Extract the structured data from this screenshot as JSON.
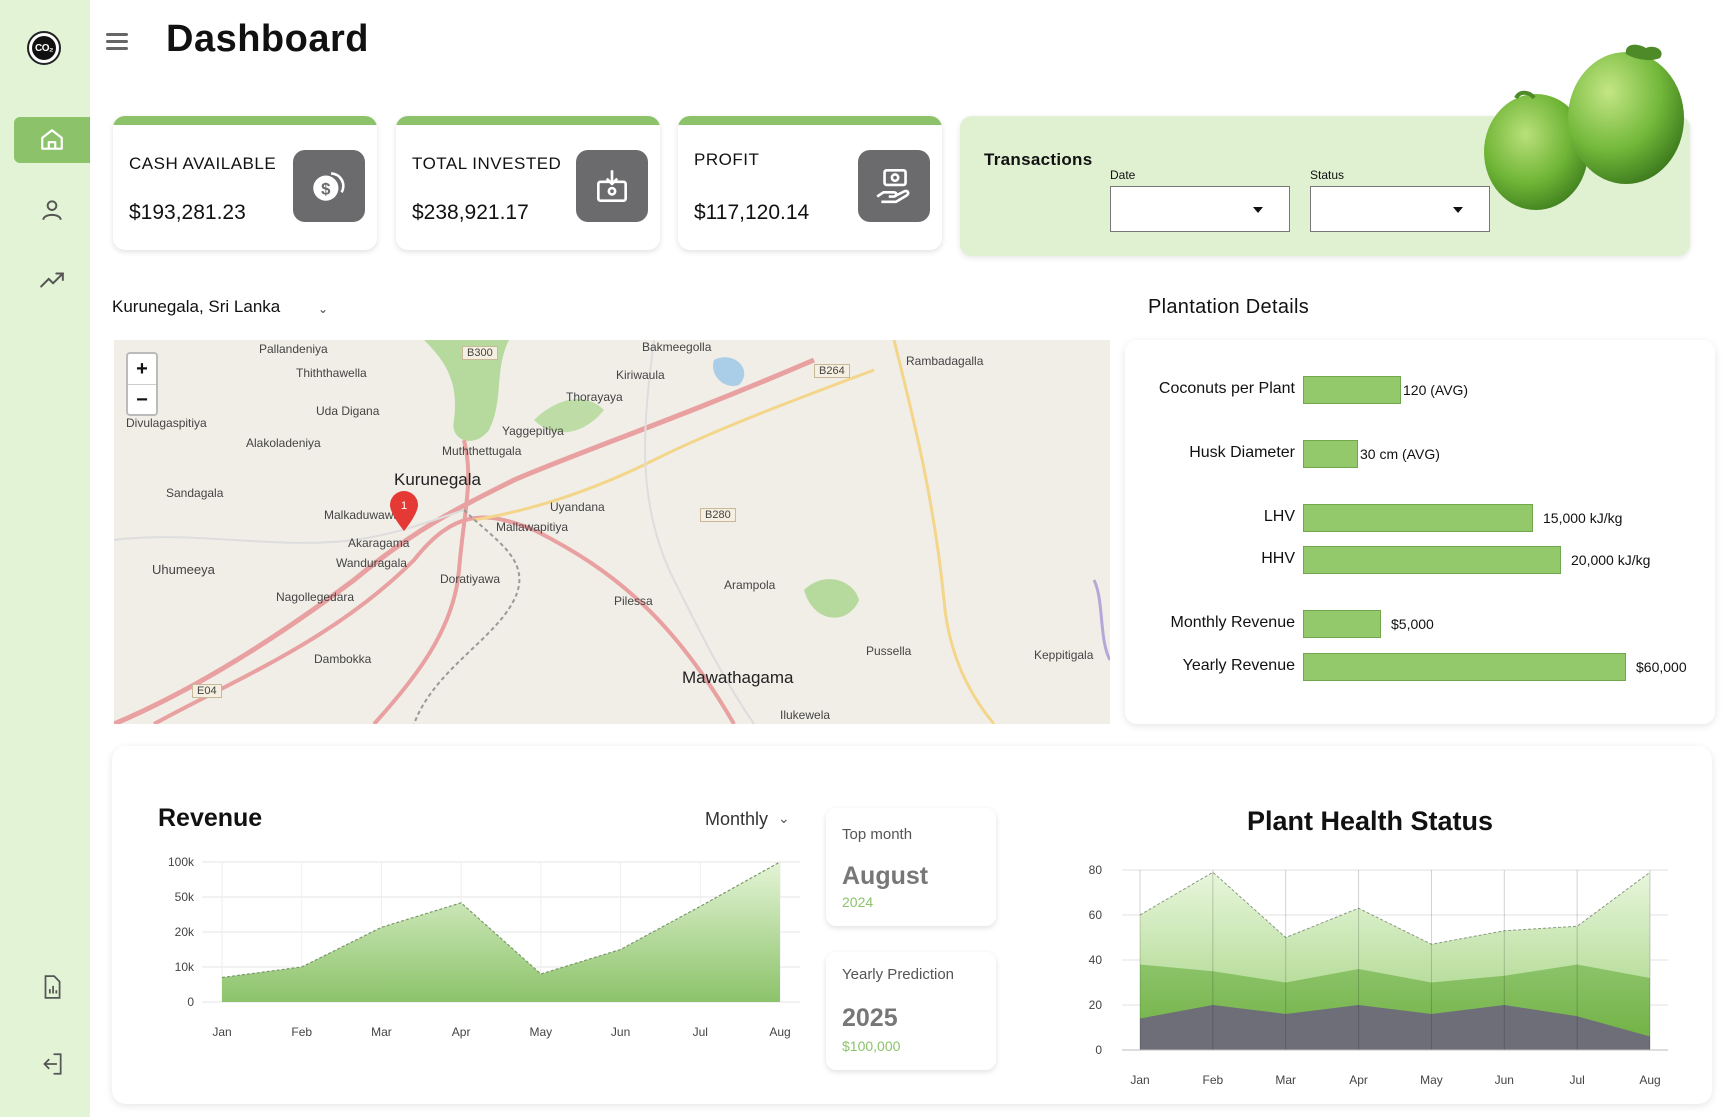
{
  "app": {
    "title": "Dashboard",
    "logo_text": "CO₂"
  },
  "sidebar": {
    "items": [
      {
        "name": "home",
        "icon": "home-icon",
        "active": true
      },
      {
        "name": "profile",
        "icon": "user-icon"
      },
      {
        "name": "analytics",
        "icon": "trending-up-icon"
      },
      {
        "name": "reports",
        "icon": "report-icon"
      },
      {
        "name": "logout",
        "icon": "logout-icon"
      }
    ]
  },
  "stats": [
    {
      "label": "CASH AVAILABLE",
      "value": "$193,281.23",
      "icon": "coins-icon"
    },
    {
      "label": "TOTAL INVESTED",
      "value": "$238,921.17",
      "icon": "invest-box-icon"
    },
    {
      "label": "PROFIT",
      "value": "$117,120.14",
      "icon": "money-hand-icon"
    }
  ],
  "transactions": {
    "title": "Transactions",
    "date_label": "Date",
    "status_label": "Status",
    "date_value": "",
    "status_value": ""
  },
  "location": {
    "selected": "Kurunegala, Sri Lanka"
  },
  "map": {
    "labels": [
      "Pallandeniya",
      "Thiththawella",
      "Uda Digana",
      "Divulagaspitiya",
      "Alakoladeniya",
      "Sandagala",
      "Malkaduwawa",
      "Akaragama",
      "Wanduragala",
      "Uhumeeya",
      "Nagollegedara",
      "Dambokka",
      "Bakmeegolla",
      "Kiriwaula",
      "Thorayaya",
      "Yaggepitiya",
      "Muththettugala",
      "Uyandana",
      "Mallawapitiya",
      "Doratiyawa",
      "Pilessa",
      "Arampola",
      "Rambadagalla",
      "Pussella",
      "Keppitigala",
      "Ilukewela"
    ],
    "big_labels": [
      "Kurunegala",
      "Mawathagama"
    ],
    "roads": [
      "B300",
      "B264",
      "B280",
      "E04"
    ],
    "zoom_in": "+",
    "zoom_out": "−",
    "marker_count": "1"
  },
  "plantation": {
    "title": "Plantation Details",
    "rows": [
      {
        "label": "Coconuts per Plant",
        "value_text": "120 (AVG)",
        "value": 120
      },
      {
        "label": "Husk Diameter",
        "value_text": "30 cm  (AVG)",
        "value": 30
      },
      {
        "label": "LHV",
        "value_text": "15,000 kJ/kg",
        "value": 15000
      },
      {
        "label": "HHV",
        "value_text": "20,000 kJ/kg",
        "value": 20000
      },
      {
        "label": "Monthly Revenue",
        "value_text": "$5,000",
        "value": 5000
      },
      {
        "label": "Yearly Revenue",
        "value_text": "$60,000",
        "value": 60000
      }
    ]
  },
  "revenue": {
    "title": "Revenue",
    "period": "Monthly"
  },
  "top_month": {
    "label": "Top month",
    "month": "August",
    "year": "2024"
  },
  "prediction": {
    "label": "Yearly Prediction",
    "year": "2025",
    "amount": "$100,000"
  },
  "health": {
    "title": "Plant Health Status"
  },
  "colors": {
    "accent": "#8cc36a",
    "sidebar_bg": "#e3f3d6",
    "card_green": "#e0f1d1",
    "icon_bg": "#6b6b6d"
  },
  "chart_data": [
    {
      "type": "area",
      "x": [
        "Jan",
        "Feb",
        "Mar",
        "Apr",
        "May",
        "Jun",
        "Jul",
        "Aug"
      ],
      "y_ticks": [
        "100k",
        "50k",
        "20k",
        "10k",
        "0"
      ],
      "series": [
        {
          "values": [
            7000,
            10000,
            24000,
            45000,
            8000,
            15000,
            42000,
            100000
          ]
        }
      ],
      "ylim": [
        0,
        100000
      ],
      "grid": true
    },
    {
      "type": "area",
      "x": [
        "Jan",
        "Feb",
        "Mar",
        "Apr",
        "May",
        "Jun",
        "Jul",
        "Aug"
      ],
      "y_ticks": [
        80,
        60,
        40,
        20,
        0
      ],
      "series": [
        {
          "values": [
            60,
            79,
            50,
            63,
            47,
            53,
            55,
            79
          ]
        },
        {
          "values": [
            38,
            35,
            30,
            36,
            30,
            33,
            38,
            32
          ]
        },
        {
          "values": [
            14,
            20,
            16,
            20,
            16,
            20,
            15,
            6
          ]
        }
      ],
      "ylim": [
        0,
        80
      ],
      "grid": true
    }
  ]
}
